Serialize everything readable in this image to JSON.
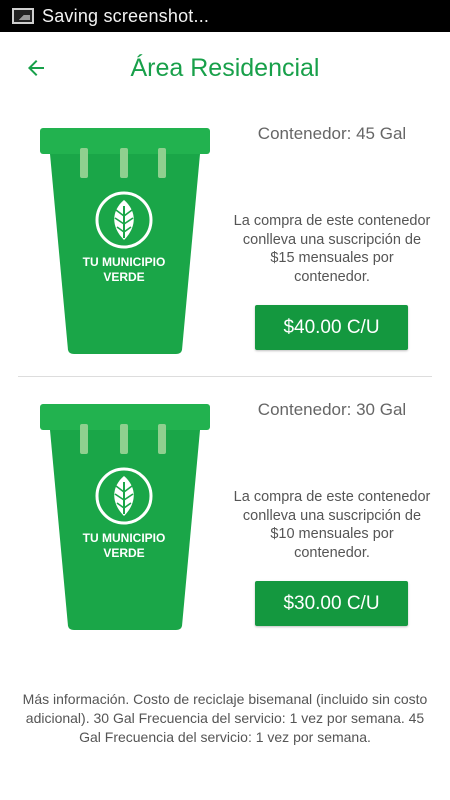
{
  "status_bar": {
    "text": "Saving screenshot...",
    "icon": "screenshot-icon"
  },
  "header": {
    "title": "Área Residencial",
    "back_icon": "arrow-left-icon",
    "accent_color": "#18a04a"
  },
  "products": [
    {
      "title": "Contenedor: 45 Gal",
      "description": "La compra de este contenedor conlleva una suscripción de $15 mensuales por contenedor.",
      "price": "$40.00 C/U",
      "bin_label_line1": "TU MUNICIPIO",
      "bin_label_line2": "VERDE"
    },
    {
      "title": "Contenedor: 30 Gal",
      "description": "La compra de este contenedor conlleva una suscripción de $10 mensuales por contenedor.",
      "price": "$30.00 C/U",
      "bin_label_line1": "TU MUNICIPIO",
      "bin_label_line2": "VERDE"
    }
  ],
  "footer": {
    "info": "Más información. Costo de reciclaje bisemanal (incluido sin costo adicional). 30 Gal Frecuencia del servicio: 1 vez por semana. 45 Gal Frecuencia del servicio: 1 vez por semana."
  },
  "colors": {
    "button": "#14983f",
    "bin_body": "#1aa648",
    "bin_lid": "#22b24f"
  }
}
